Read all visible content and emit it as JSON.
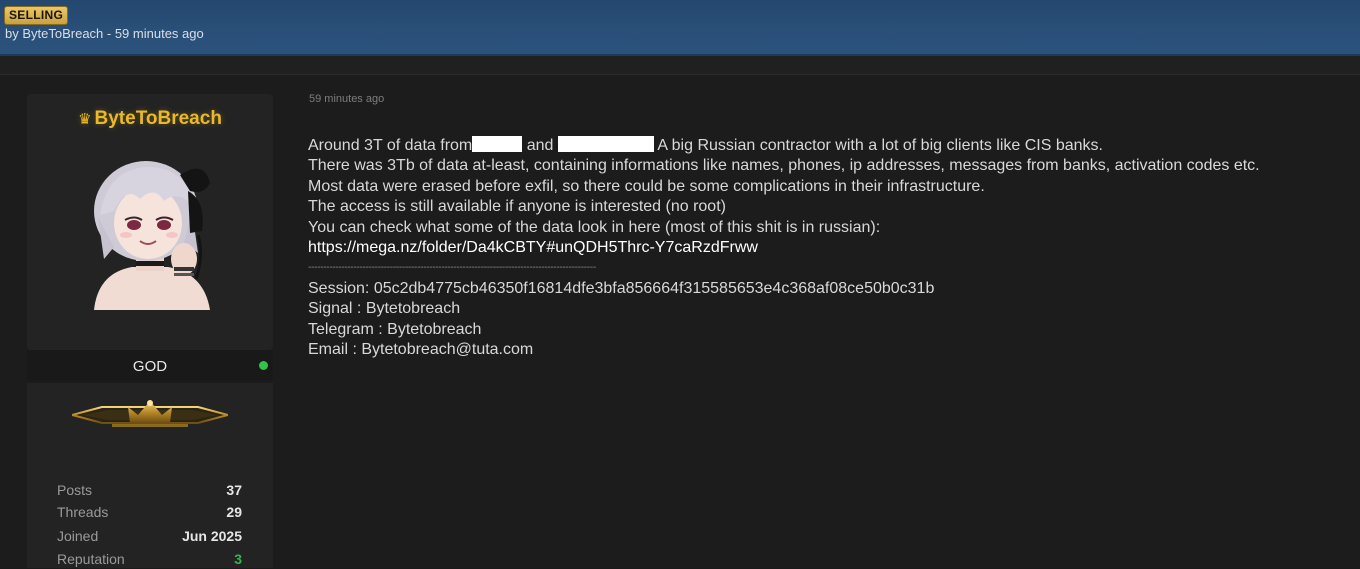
{
  "thread": {
    "badge": "SELLING",
    "byline": "by ByteToBreach - 59 minutes ago"
  },
  "user": {
    "crown_icon": "crown-icon",
    "name": "ByteToBreach",
    "rank": "GOD",
    "online_status_color": "#33c24a",
    "stats": [
      {
        "label": "Posts",
        "value": "37"
      },
      {
        "label": "Threads",
        "value": "29"
      },
      {
        "label": "Joined",
        "value": "Jun 2025"
      },
      {
        "label": "Reputation",
        "value": "3"
      }
    ]
  },
  "post": {
    "time": "59 minutes ago",
    "line1_a": "Around 3T of data from",
    "line1_b": "and",
    "line1_c": " A big Russian contractor with a lot of big clients like CIS banks.",
    "line2": "There was 3Tb of data at-least, containing informations like names, phones, ip addresses, messages from banks, activation codes etc.",
    "line3": "Most data were erased before exfil, so there could be some complications in their infrastructure.",
    "line4": "The access is still available if anyone is interested (no root)",
    "line5": "You can check what some of the data look in here (most of this shit is in russian):",
    "link": "https://mega.nz/folder/Da4kCBTY#unQDH5Thrc-Y7caRzdFrww",
    "divider": "-----------------------------------------------------------------------------------------------",
    "session": "Session: 05c2db4775cb46350f16814dfe3bfa856664f315585653e4c368af08ce50b0c31b",
    "signal": "Signal : Bytetobreach",
    "telegram": "Telegram : Bytetobreach",
    "email": "Email : Bytetobreach@tuta.com"
  },
  "colors": {
    "header_bg": "#2a5079",
    "username": "#e9b92a",
    "badge": "#d9b452",
    "reputation": "#2fb84a"
  }
}
